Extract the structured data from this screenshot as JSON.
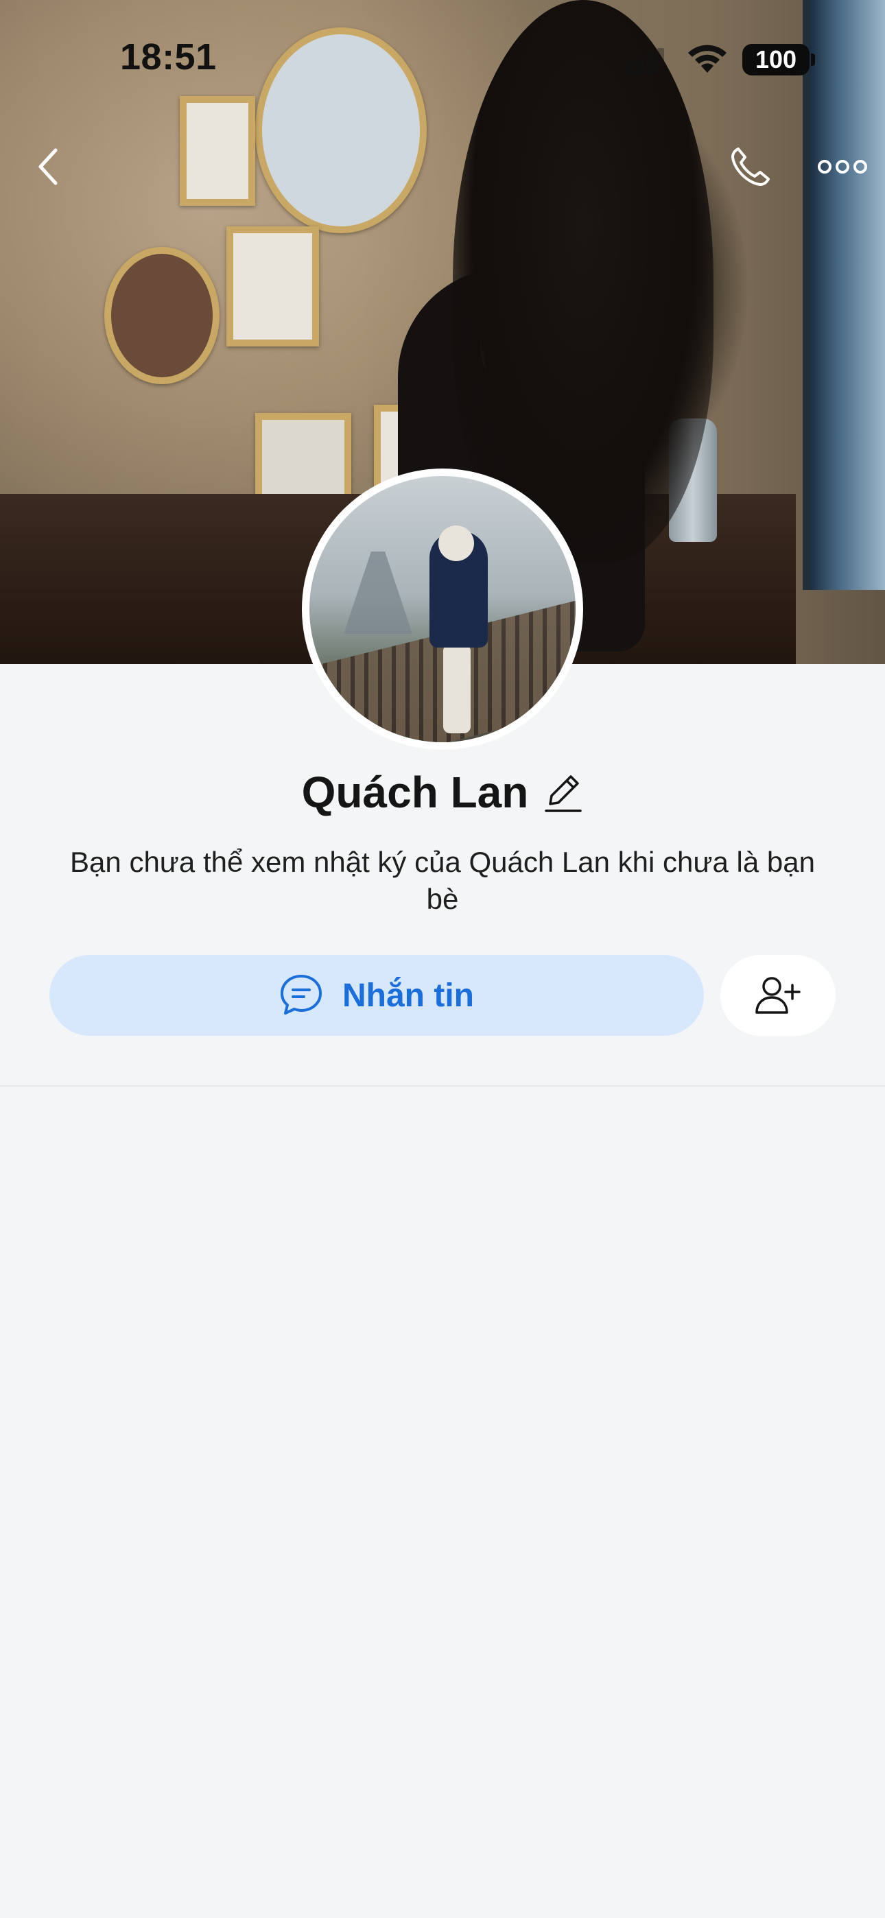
{
  "status_bar": {
    "time": "18:51",
    "battery": "100",
    "icons": [
      "signal-icon",
      "wifi-icon",
      "battery-icon"
    ]
  },
  "nav": {
    "icons": [
      "back-chevron-icon",
      "phone-icon",
      "more-dots-icon"
    ]
  },
  "profile": {
    "name": "Quách Lan",
    "notice": "Bạn chưa thể xem nhật ký của Quách Lan khi chưa là bạn bè"
  },
  "actions": {
    "message_label": "Nhắn tin",
    "icons": [
      "chat-bubble-icon",
      "edit-pencil-icon",
      "add-friend-icon"
    ]
  },
  "colors": {
    "accent": "#1b6fdc",
    "message_button_bg": "#d8e8fc",
    "page_bg": "#f4f5f7"
  }
}
